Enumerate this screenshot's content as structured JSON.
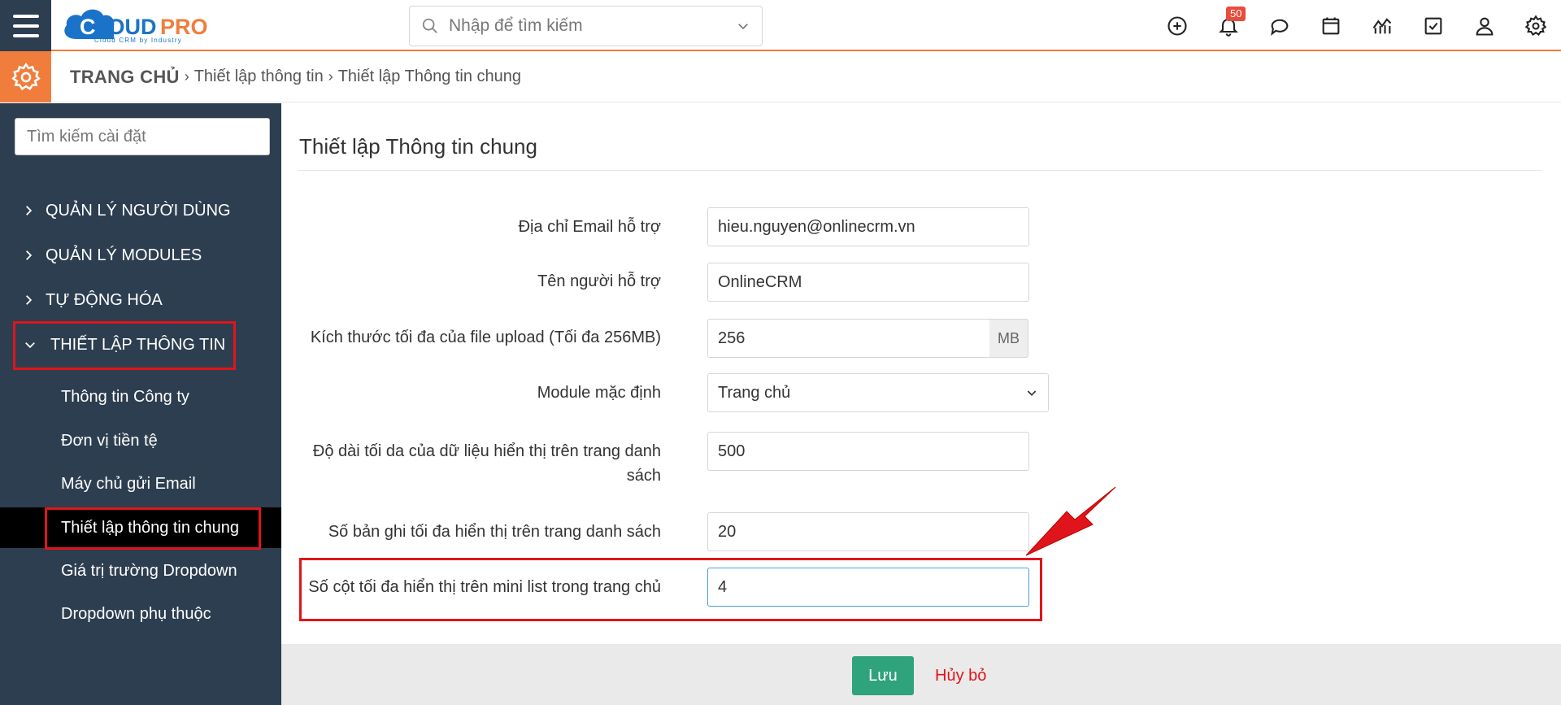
{
  "topbar": {
    "logo_text": "CLOUDPRO",
    "logo_tagline": "Cloud CRM by Industry",
    "search_placeholder": "Nhập để tìm kiếm",
    "notification_count": "50",
    "icons": [
      "plus-circle-icon",
      "bell-icon",
      "chat-icon",
      "calendar-icon",
      "chart-icon",
      "checkbox-icon",
      "user-icon",
      "gear-icon"
    ]
  },
  "breadcrumb": {
    "home": "TRANG CHỦ",
    "level1": "Thiết lập thông tin",
    "level2": "Thiết lập Thông tin chung"
  },
  "sidebar": {
    "search_placeholder": "Tìm kiếm cài đặt",
    "sections": [
      {
        "label": "QUẢN LÝ NGƯỜI DÙNG"
      },
      {
        "label": "QUẢN LÝ MODULES"
      },
      {
        "label": "TỰ ĐỘNG HÓA"
      },
      {
        "label": "THIẾT LẬP THÔNG TIN"
      }
    ],
    "sub_items": [
      {
        "label": "Thông tin Công ty"
      },
      {
        "label": "Đơn vị tiền tệ"
      },
      {
        "label": "Máy chủ gửi Email"
      },
      {
        "label": "Thiết lập thông tin chung"
      },
      {
        "label": "Giá trị trường Dropdown"
      },
      {
        "label": "Dropdown phụ thuộc"
      }
    ]
  },
  "main": {
    "title": "Thiết lập Thông tin chung",
    "fields": [
      {
        "label": "Địa chỉ Email hỗ trợ",
        "value": "hieu.nguyen@onlinecrm.vn"
      },
      {
        "label": "Tên người hỗ trợ",
        "value": "OnlineCRM"
      },
      {
        "label": "Kích thước tối đa của file upload (Tối đa 256MB)",
        "value": "256",
        "addon": "MB"
      },
      {
        "label": "Module mặc định",
        "value": "Trang chủ"
      },
      {
        "label_line1": "Độ dài tối da của dữ liệu hiển thị trên trang danh",
        "label_line2": "sách",
        "value": "500"
      },
      {
        "label": "Số bản ghi tối đa hiển thị trên trang danh sách",
        "value": "20"
      },
      {
        "label": "Số cột tối đa hiển thị trên mini list trong trang chủ",
        "value": "4"
      }
    ]
  },
  "footer": {
    "save_label": "Lưu",
    "cancel_label": "Hủy bỏ"
  },
  "colors": {
    "accent_orange": "#f07d3c",
    "sidebar_bg": "#2d3e50",
    "save_green": "#2fa37b",
    "highlight_red": "#e0151b"
  }
}
